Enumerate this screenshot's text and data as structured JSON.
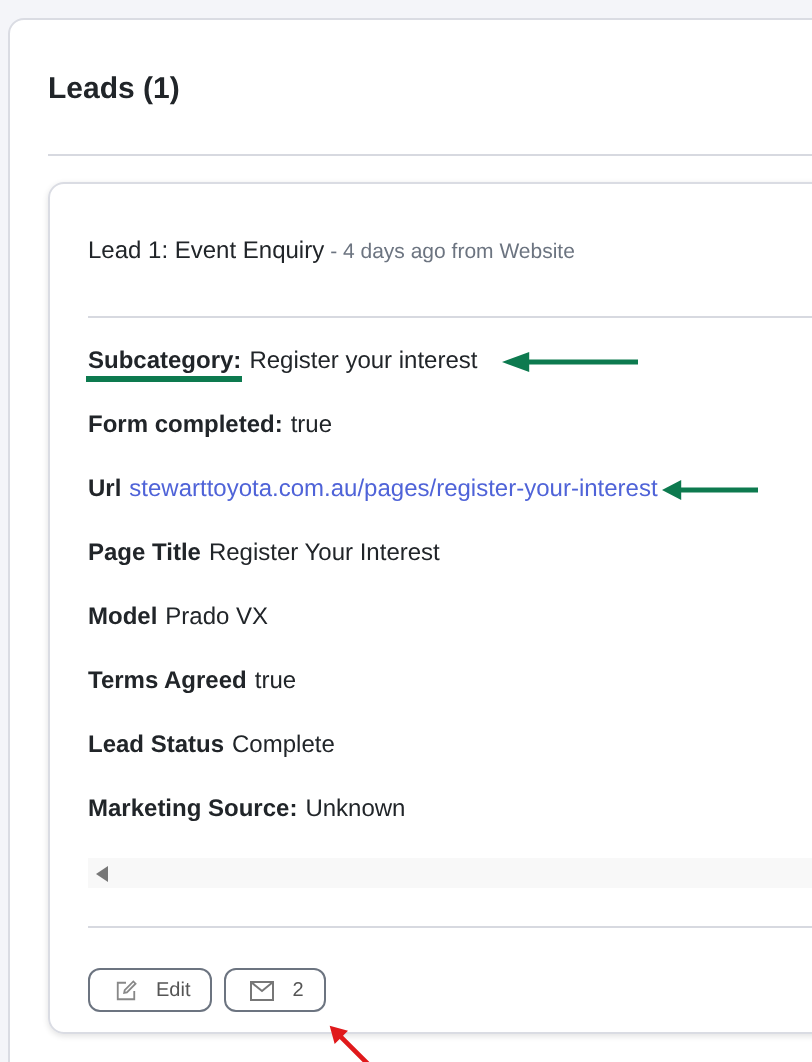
{
  "panel": {
    "title": "Leads (1)"
  },
  "lead": {
    "title": "Lead 1: Event Enquiry",
    "meta": "- 4 days ago from Website",
    "fields": [
      {
        "label": "Subcategory:",
        "value": "Register your interest",
        "kind": "text",
        "underlined": true,
        "arrow": true
      },
      {
        "label": "Form completed:",
        "value": "true",
        "kind": "text",
        "underlined": false,
        "arrow": false
      },
      {
        "label": "Url",
        "value": "stewarttoyota.com.au/pages/register-your-interest",
        "kind": "link",
        "underlined": false,
        "arrow": true
      },
      {
        "label": "Page Title",
        "value": "Register Your Interest",
        "kind": "text",
        "underlined": false,
        "arrow": false
      },
      {
        "label": "Model",
        "value": "Prado VX",
        "kind": "text",
        "underlined": false,
        "arrow": false
      },
      {
        "label": "Terms Agreed",
        "value": "true",
        "kind": "text",
        "underlined": false,
        "arrow": false
      },
      {
        "label": "Lead Status",
        "value": "Complete",
        "kind": "text",
        "underlined": false,
        "arrow": false
      },
      {
        "label": "Marketing Source:",
        "value": "Unknown",
        "kind": "text",
        "underlined": false,
        "arrow": false
      }
    ],
    "buttons": [
      {
        "kind": "edit",
        "label": "Edit",
        "arrow": false
      },
      {
        "kind": "mail",
        "label": "2",
        "arrow": true
      }
    ]
  }
}
